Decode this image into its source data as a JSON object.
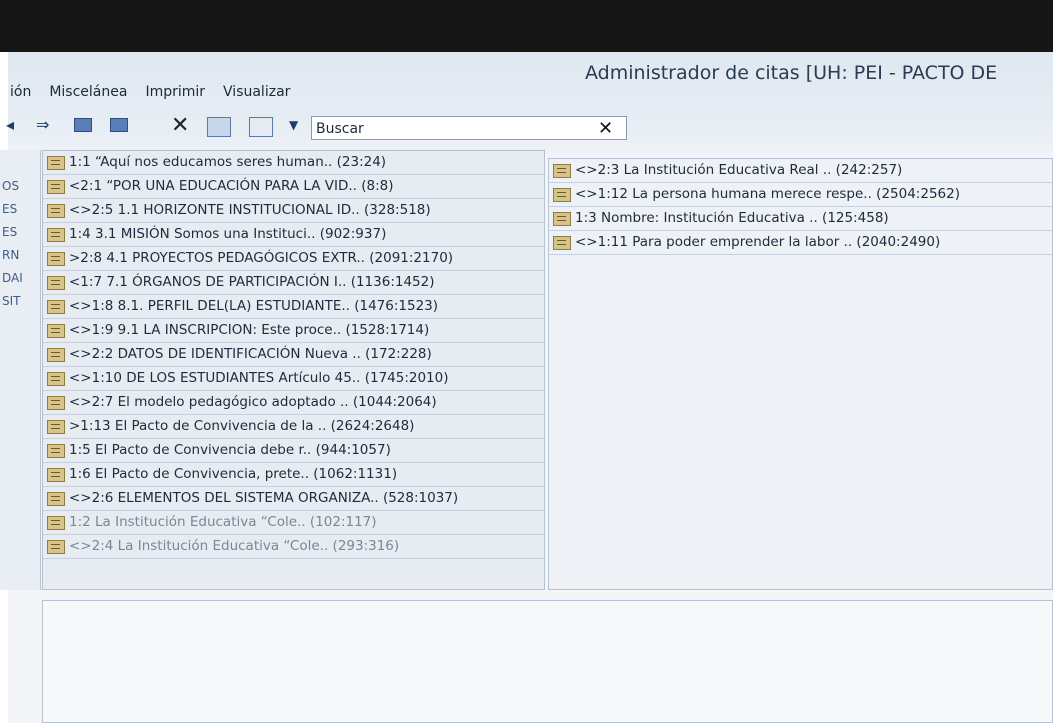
{
  "window": {
    "title": "Administrador de citas [UH: PEI - PACTO DE"
  },
  "menu": {
    "items": [
      "ión",
      "Miscelánea",
      "Imprimir",
      "Visualizar"
    ]
  },
  "toolbar": {
    "search_placeholder": "Buscar",
    "icons": [
      "back-arrow-icon",
      "forward-arrow-icon",
      "move-left-icon",
      "move-right-icon",
      "delete-x-icon",
      "pane-layout-icon",
      "grid-view-icon",
      "dropdown-icon"
    ]
  },
  "sidebar": {
    "items": [
      "OS",
      "ES",
      "ES",
      "RN",
      "DAI",
      "SIT"
    ]
  },
  "quotes_left": [
    {
      "text": "1:1 “Aquí nos educamos seres human.. (23:24)"
    },
    {
      "text": "<2:1 “POR UNA EDUCACIÓN PARA LA VID.. (8:8)"
    },
    {
      "text": "<>2:5 1.1 HORIZONTE INSTITUCIONAL ID.. (328:518)"
    },
    {
      "text": "1:4 3.1 MISIÓN Somos una Instituci.. (902:937)"
    },
    {
      "text": ">2:8 4.1 PROYECTOS PEDAGÓGICOS EXTR.. (2091:2170)"
    },
    {
      "text": "<1:7 7.1 ÓRGANOS DE PARTICIPACIÓN I.. (1136:1452)"
    },
    {
      "text": "<>1:8 8.1. PERFIL DEL(LA) ESTUDIANTE.. (1476:1523)"
    },
    {
      "text": "<>1:9 9.1 LA INSCRIPCION: Este proce.. (1528:1714)"
    },
    {
      "text": "<>2:2 DATOS DE IDENTIFICACIÓN Nueva .. (172:228)"
    },
    {
      "text": "<>1:10 DE LOS ESTUDIANTES Artículo 45.. (1745:2010)"
    },
    {
      "text": "<>2:7 El modelo pedagógico adoptado .. (1044:2064)"
    },
    {
      "text": ">1:13 El Pacto de Convivencia de la .. (2624:2648)"
    },
    {
      "text": "1:5 El Pacto de Convivencia debe r.. (944:1057)"
    },
    {
      "text": "1:6 El Pacto de Convivencia, prete.. (1062:1131)"
    },
    {
      "text": "<>2:6 ELEMENTOS DEL SISTEMA ORGANIZA.. (528:1037)"
    },
    {
      "text": "1:2 La Institución Educativa “Cole.. (102:117)"
    },
    {
      "text": "<>2:4 La Institución Educativa “Cole.. (293:316)"
    }
  ],
  "quotes_right": [
    {
      "text": "<>2:3 La Institución Educativa Real .. (242:257)"
    },
    {
      "text": "<>1:12 La persona humana merece respe.. (2504:2562)"
    },
    {
      "text": "1:3 Nombre: Institución Educativa .. (125:458)"
    },
    {
      "text": "<>1:11 Para poder emprender la labor .. (2040:2490)"
    }
  ]
}
